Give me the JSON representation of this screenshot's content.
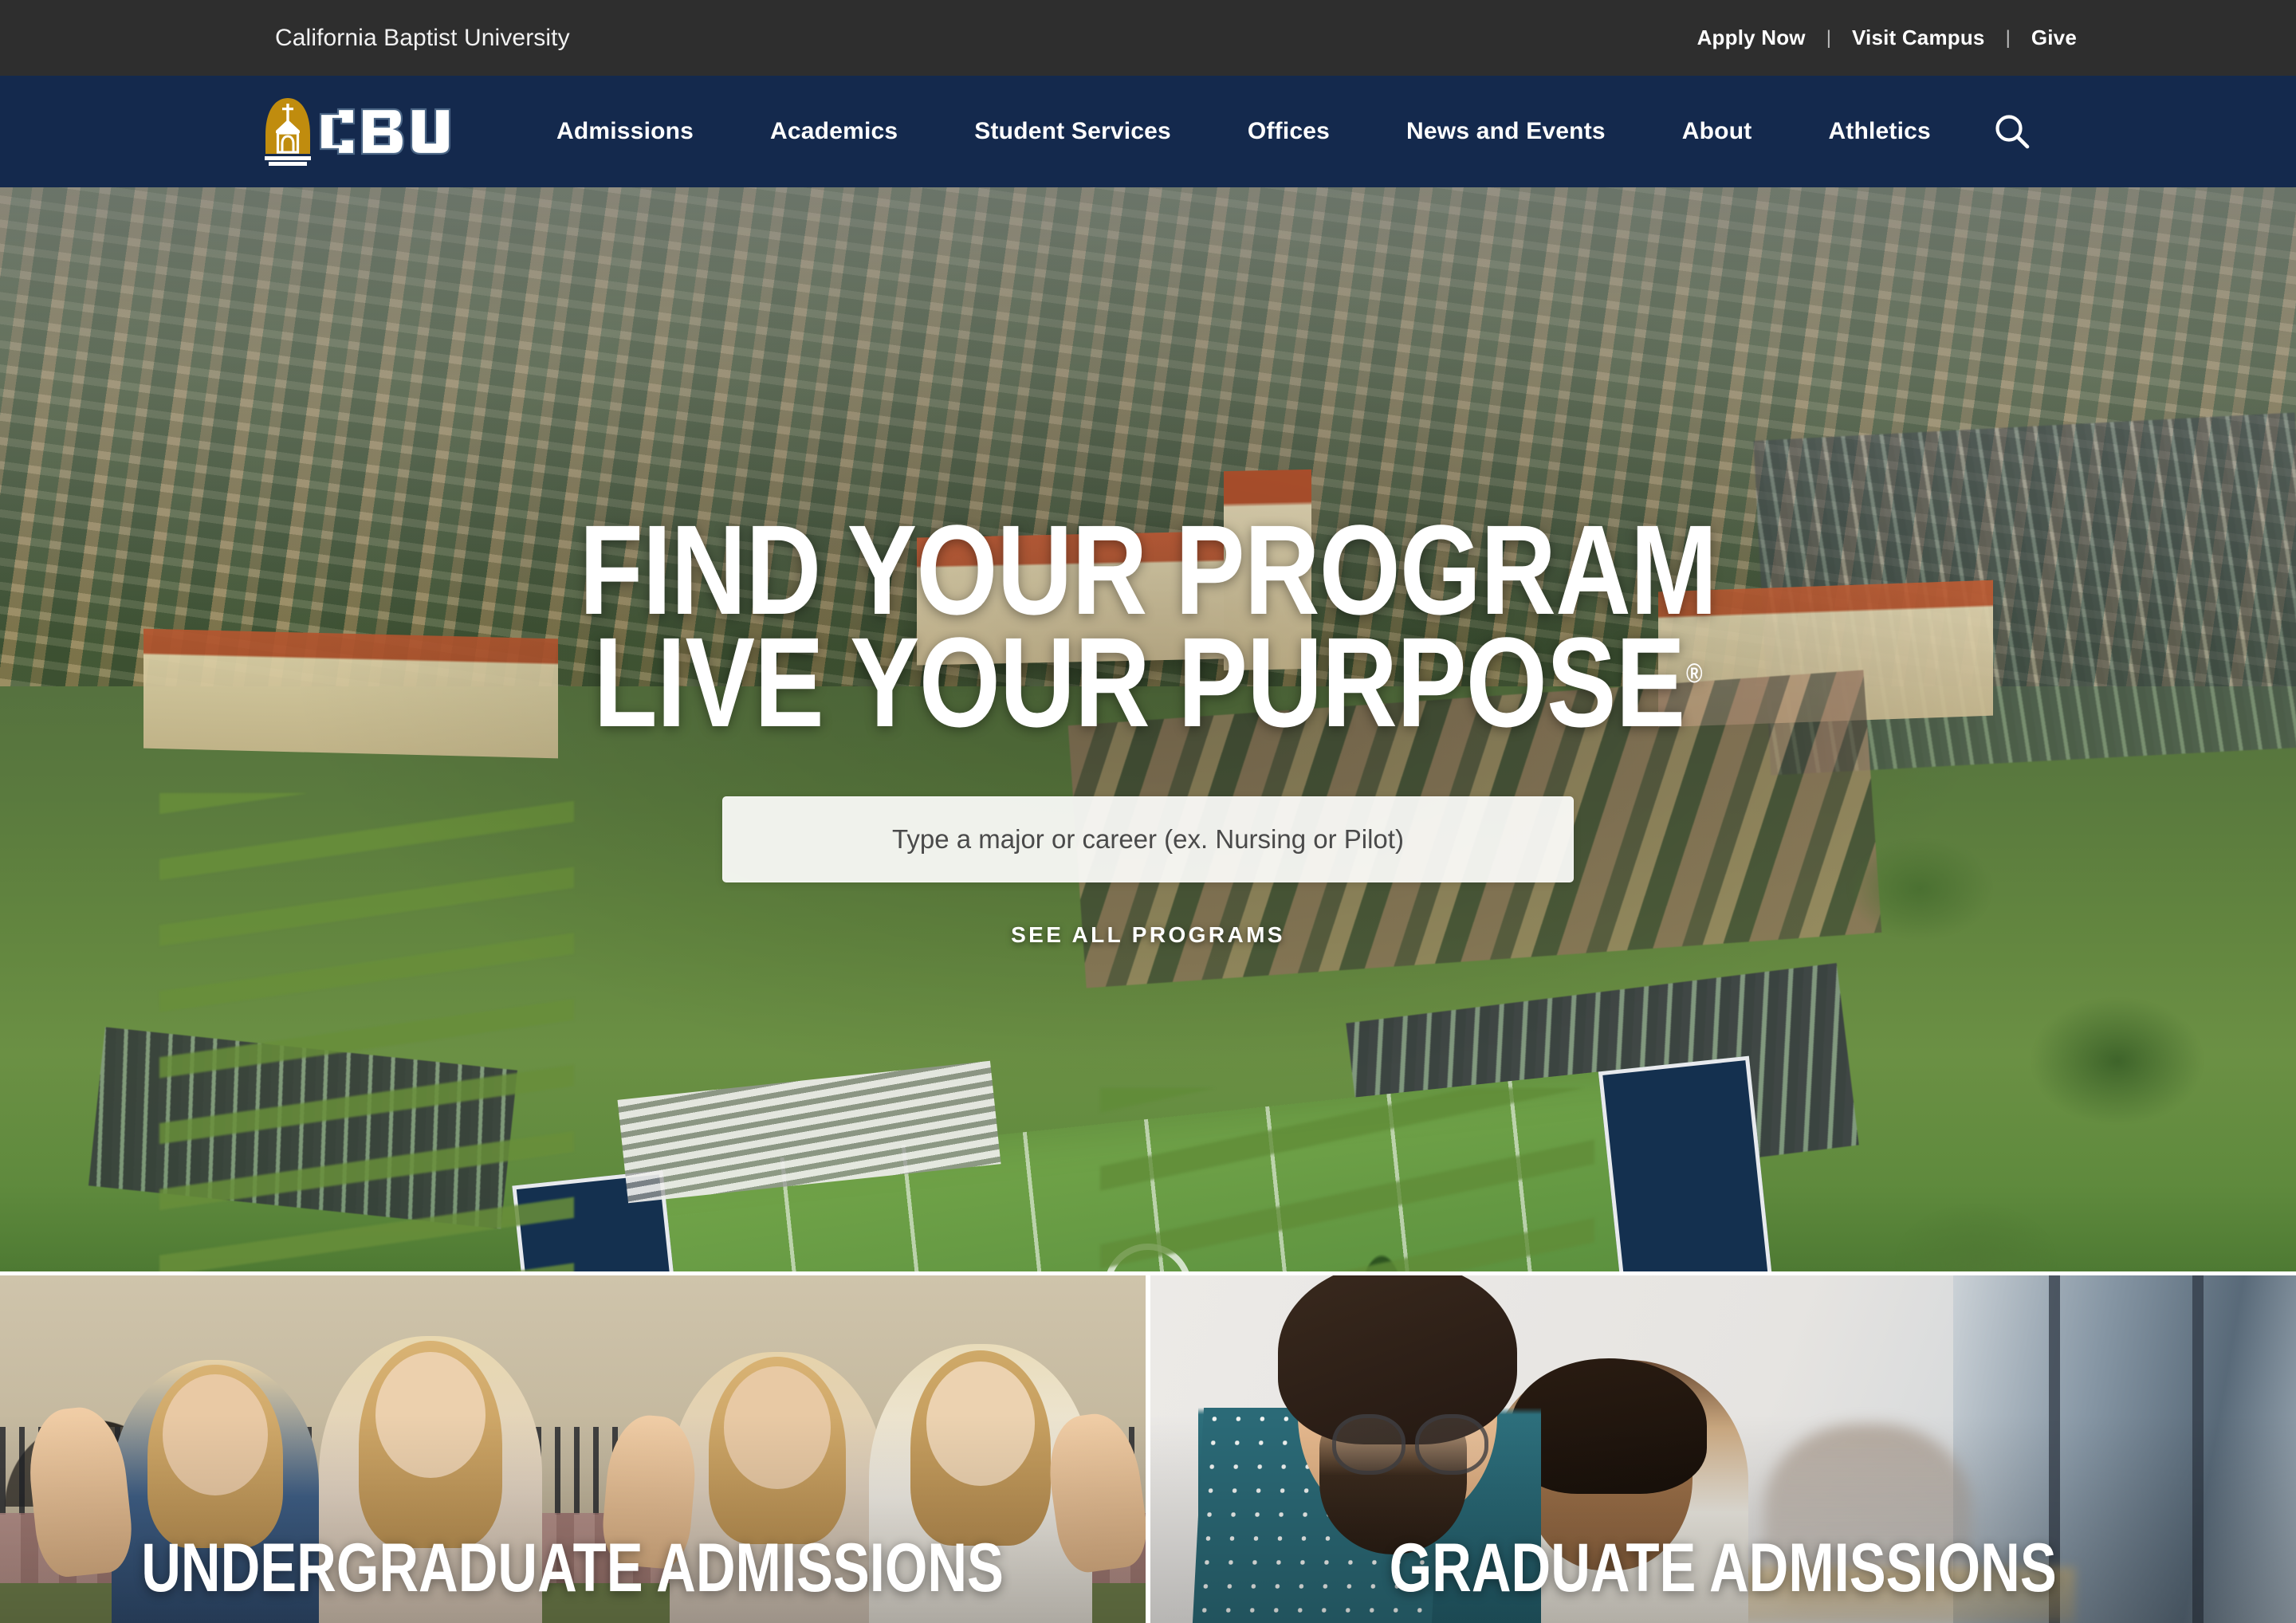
{
  "topbar": {
    "brand": "California Baptist University",
    "links": [
      {
        "label": "Apply Now",
        "name": "apply-now"
      },
      {
        "label": "Visit Campus",
        "name": "visit-campus"
      },
      {
        "label": "Give",
        "name": "give"
      }
    ],
    "separator": "|",
    "bg_color": "#2e2e2e"
  },
  "nav": {
    "logo": {
      "icon": "cbu-chapel-logo-icon",
      "wordmark": "CBU",
      "alt": "CBU"
    },
    "items": [
      {
        "label": "Admissions",
        "name": "admissions"
      },
      {
        "label": "Academics",
        "name": "academics"
      },
      {
        "label": "Student Services",
        "name": "student-services"
      },
      {
        "label": "Offices",
        "name": "offices"
      },
      {
        "label": "News and Events",
        "name": "news-and-events"
      },
      {
        "label": "About",
        "name": "about"
      },
      {
        "label": "Athletics",
        "name": "athletics"
      }
    ],
    "search_icon": "search-icon",
    "bg_color": "#14294d",
    "gold_color": "#c08c0e"
  },
  "hero": {
    "headline_line1": "FIND YOUR PROGRAM",
    "headline_line2": "LIVE YOUR PURPOSE",
    "trademark": "®",
    "search_placeholder": "Type a major or career (ex. Nursing or Pilot)",
    "search_value": "",
    "cta_label": "SEE ALL PROGRAMS",
    "image_alt": "Aerial view of the California Baptist University campus with Spanish-style buildings, palm trees and the athletic field"
  },
  "cards": [
    {
      "title": "UNDERGRADUATE ADMISSIONS",
      "name": "undergraduate-admissions",
      "image_alt": "Four smiling students making hand gestures in front of a Spanish-style arcade"
    },
    {
      "title": "GRADUATE ADMISSIONS",
      "name": "graduate-admissions",
      "image_alt": "Two graduate students working together near a window"
    }
  ]
}
